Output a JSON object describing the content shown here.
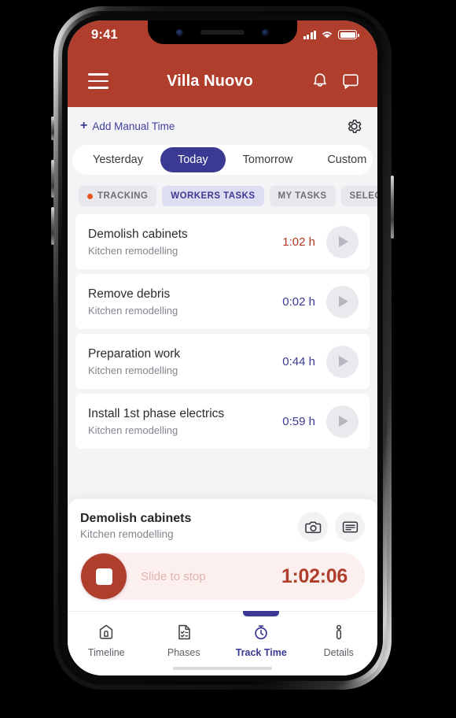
{
  "status_bar": {
    "time": "9:41",
    "signal_icon": "cellular-signal-icon",
    "wifi_icon": "wifi-icon",
    "battery_icon": "battery-full-icon"
  },
  "header": {
    "menu_icon": "hamburger-menu-icon",
    "title": "Villa Nuovo",
    "notifications_icon": "bell-icon",
    "board_icon": "presentation-board-icon",
    "background_color": "#b03e2c"
  },
  "manual_time": {
    "plus": "+",
    "label": "Add Manual Time",
    "settings_icon": "gear-icon",
    "link_color": "#3f3fa0"
  },
  "day_tabs": {
    "active": "Today",
    "items": [
      {
        "label": "Yesterday",
        "active": false
      },
      {
        "label": "Today",
        "active": true
      },
      {
        "label": "Tomorrow",
        "active": false
      },
      {
        "label": "Custom",
        "active": false
      }
    ],
    "active_color": "#3a3a94"
  },
  "filter_pills": [
    {
      "label": "TRACKING",
      "active": false,
      "dot": true,
      "dot_color": "#e8521f"
    },
    {
      "label": "WORKERS TASKS",
      "active": true,
      "dot": false
    },
    {
      "label": "MY TASKS",
      "active": false,
      "dot": false
    },
    {
      "label": "SELECTED",
      "active": false,
      "dot": false
    }
  ],
  "tasks": [
    {
      "title": "Demolish cabinets",
      "project": "Kitchen remodelling",
      "time": "1:02 h",
      "running": true
    },
    {
      "title": "Remove debris",
      "project": "Kitchen remodelling",
      "time": "0:02 h",
      "running": false
    },
    {
      "title": "Preparation work",
      "project": "Kitchen remodelling",
      "time": "0:44 h",
      "running": false
    },
    {
      "title": "Install 1st phase electrics",
      "project": "Kitchen remodelling",
      "time": "0:59 h",
      "running": false
    }
  ],
  "timer_panel": {
    "title": "Demolish cabinets",
    "project": "Kitchen remodelling",
    "camera_icon": "camera-icon",
    "note_icon": "note-icon",
    "slide_label": "Slide to stop",
    "elapsed": "1:02:06",
    "accent_color": "#b03e2c",
    "stop_icon": "stop-square-icon"
  },
  "bottom_nav": {
    "active": "Track Time",
    "items": [
      {
        "label": "Timeline",
        "icon": "home-icon",
        "active": false
      },
      {
        "label": "Phases",
        "icon": "checklist-document-icon",
        "active": false
      },
      {
        "label": "Track Time",
        "icon": "stopwatch-icon",
        "active": true
      },
      {
        "label": "Details",
        "icon": "info-pin-icon",
        "active": false
      }
    ],
    "active_color": "#3a3a94"
  }
}
